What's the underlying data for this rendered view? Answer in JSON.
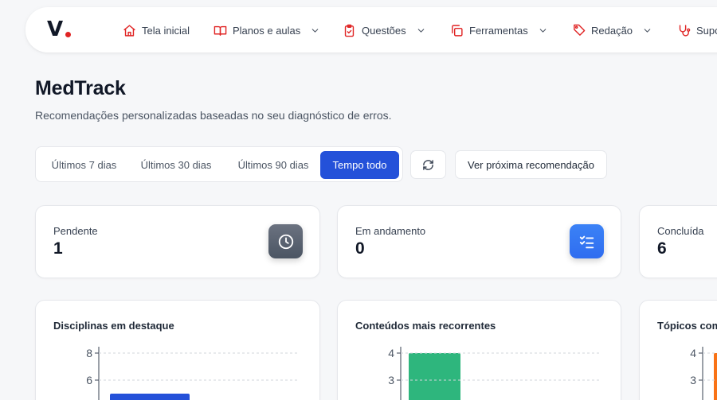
{
  "nav": {
    "logo": "V",
    "items": [
      {
        "label": "Tela inicial",
        "icon": "home-icon",
        "has_menu": false
      },
      {
        "label": "Planos e aulas",
        "icon": "book-open-icon",
        "has_menu": true
      },
      {
        "label": "Questões",
        "icon": "clipboard-check-icon",
        "has_menu": true
      },
      {
        "label": "Ferramentas",
        "icon": "copy-icon",
        "has_menu": true
      },
      {
        "label": "Redação",
        "icon": "pen-tag-icon",
        "has_menu": true
      },
      {
        "label": "Supo",
        "icon": "stethoscope-icon",
        "has_menu": false
      }
    ],
    "accent_color": "#e02424"
  },
  "header": {
    "title": "MedTrack",
    "subtitle": "Recomendações personalizadas baseadas no seu diagnóstico de erros."
  },
  "filters": {
    "periods": [
      "Últimos 7 dias",
      "Últimos 30 dias",
      "Últimos 90 dias",
      "Tempo todo"
    ],
    "selected": "Tempo todo",
    "selected_color": "#2451d9",
    "next_recommendation_label": "Ver próxima recomendação"
  },
  "stats": [
    {
      "label": "Pendente",
      "value": "1",
      "icon": "clock-icon",
      "color": "#4b5563"
    },
    {
      "label": "Em andamento",
      "value": "0",
      "icon": "checklist-icon",
      "color": "#2f6df0"
    },
    {
      "label": "Concluída",
      "value": "6",
      "icon": "",
      "color": ""
    }
  ],
  "charts": [
    {
      "title": "Disciplinas em destaque",
      "bar_color": "#2451d9"
    },
    {
      "title": "Conteúdos mais recorrentes",
      "bar_color": "#2eb67d"
    },
    {
      "title": "Tópicos com",
      "bar_color": "#f97316"
    }
  ],
  "chart_data": [
    {
      "type": "bar",
      "title": "Disciplinas em destaque",
      "yticks": [
        8,
        6
      ],
      "ylim": [
        0,
        8
      ],
      "values": [
        5
      ],
      "grid": true
    },
    {
      "type": "bar",
      "title": "Conteúdos mais recorrentes",
      "yticks": [
        4,
        3
      ],
      "ylim": [
        0,
        4
      ],
      "values": [
        4
      ],
      "grid": true
    },
    {
      "type": "bar",
      "title": "Tópicos com",
      "yticks": [
        4,
        3
      ],
      "ylim": [
        0,
        4
      ],
      "values": [
        4
      ],
      "grid": true
    }
  ]
}
